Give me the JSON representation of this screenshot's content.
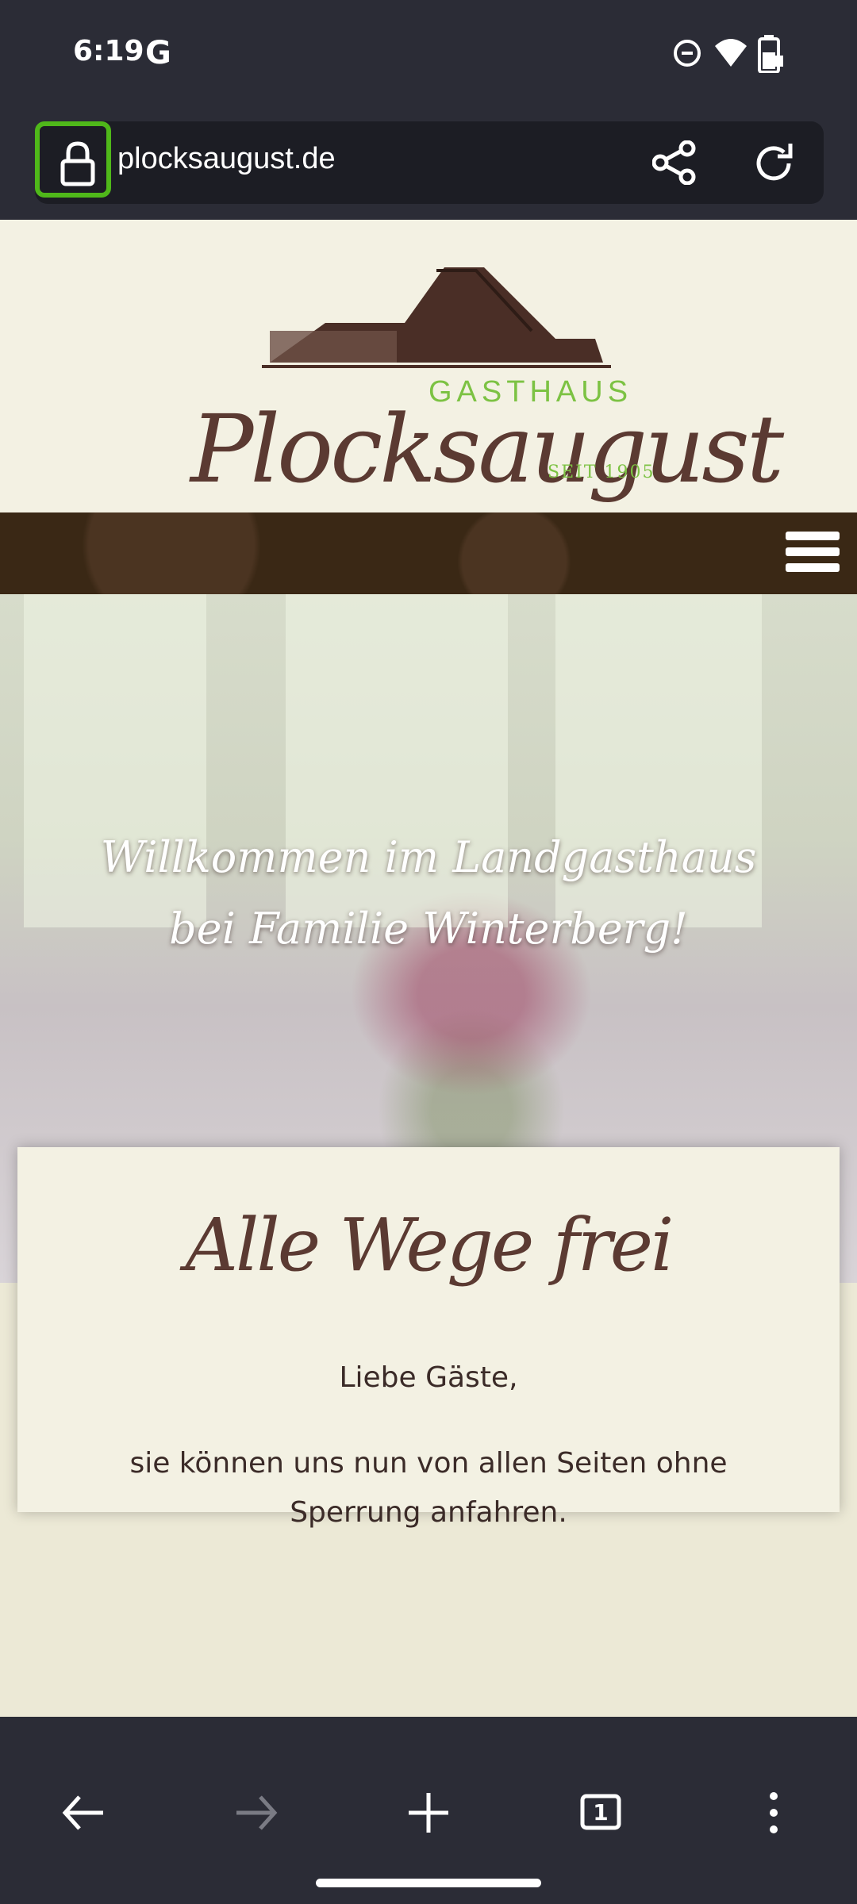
{
  "status_bar": {
    "time": "6:19",
    "app_icon": "G"
  },
  "browser": {
    "url": "plocksaugust.de",
    "tab_count": "1"
  },
  "logo": {
    "gasthaus": "GASTHAUS",
    "name": "Plocksaugust",
    "since": "SEIT 1905"
  },
  "hero": {
    "line1": "Willkommen im Landgasthaus",
    "line2": "bei Familie Winterberg!"
  },
  "card": {
    "title": "Alle Wege frei",
    "greeting": "Liebe Gäste,",
    "body": "sie können uns nun von allen Seiten ohne Sperrung anfahren."
  },
  "colors": {
    "highlight": "#4fb81a",
    "brand_brown": "#5b3a32",
    "brand_green": "#7cc243",
    "chrome": "#2b2c36"
  }
}
